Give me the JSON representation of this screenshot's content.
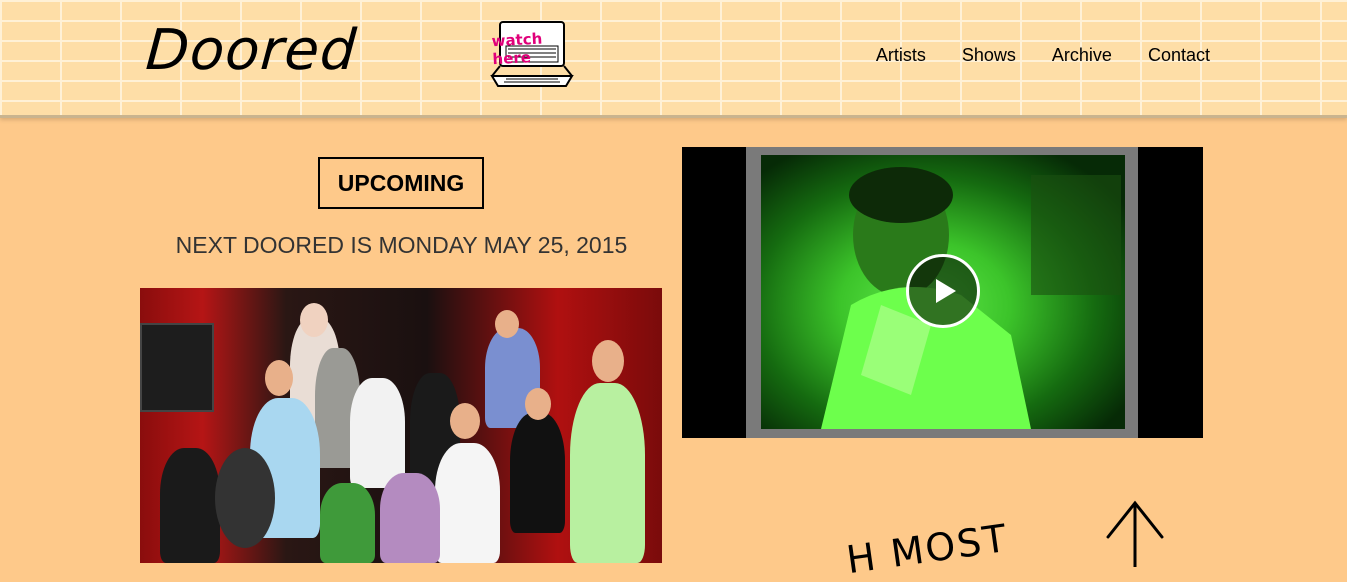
{
  "header": {
    "logo": "Doored",
    "watch_label": "watch here",
    "nav": [
      "Artists",
      "Shows",
      "Archive",
      "Contact"
    ]
  },
  "upcoming": {
    "badge": "UPCOMING",
    "next_show": "NEXT DOORED IS MONDAY MAY 25, 2015"
  },
  "video": {
    "play_icon": "play-icon"
  },
  "partial_text": "H MOST",
  "colors": {
    "background": "#fec98a",
    "header": "#fedea7",
    "accent": "#e0007a"
  }
}
